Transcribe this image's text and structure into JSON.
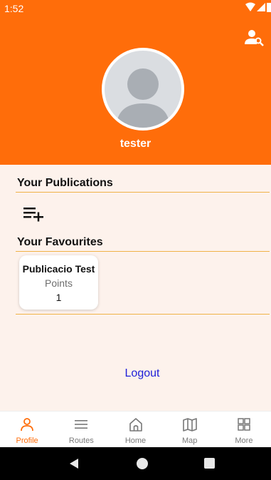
{
  "status_bar": {
    "time": "1:52"
  },
  "profile": {
    "username": "tester"
  },
  "sections": {
    "publications_title": "Your Publications",
    "favourites_title": "Your Favourites"
  },
  "favourites": [
    {
      "title": "Publicacio Test",
      "points_label": "Points",
      "points_value": "1"
    }
  ],
  "logout_label": "Logout",
  "bottom_nav": {
    "items": [
      {
        "label": "Profile",
        "icon": "person-icon",
        "active": true
      },
      {
        "label": "Routes",
        "icon": "menu-icon",
        "active": false
      },
      {
        "label": "Home",
        "icon": "home-icon",
        "active": false
      },
      {
        "label": "Map",
        "icon": "map-icon",
        "active": false
      },
      {
        "label": "More",
        "icon": "grid-icon",
        "active": false
      }
    ]
  },
  "colors": {
    "accent": "#ff6d0a",
    "background": "#fdf2ec",
    "divider": "#f0b247",
    "link": "#2020d8"
  }
}
